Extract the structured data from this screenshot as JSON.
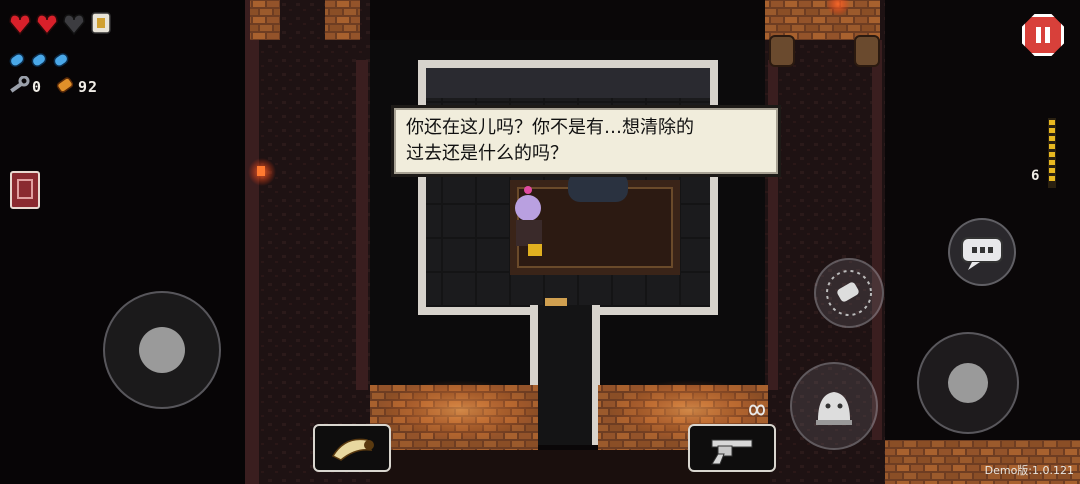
{
  "dialog": {
    "text": "你还在这儿吗？你不是有…想清除的\n过去还是什么的吗？"
  },
  "hud": {
    "hearts_full": 2,
    "hearts_empty": 1,
    "keys": "0",
    "shells": "92",
    "ammo_count": "6"
  },
  "controls": {
    "pause_icon": "pause-icon",
    "chat_icon": "chat-bubble-icon",
    "reload_icon": "reload-icon",
    "dodge_icon": "dodge-roll-icon"
  },
  "items": {
    "active_item_icon": "horn-icon",
    "gun_icon": "revolver-icon"
  },
  "version": "Demo版:1.0.121",
  "colors": {
    "heart": "#d8202a",
    "blank": "#4aa8e8",
    "shell": "#e0902a",
    "pause": "#d8403a",
    "dialog_bg": "#f1eddc"
  }
}
